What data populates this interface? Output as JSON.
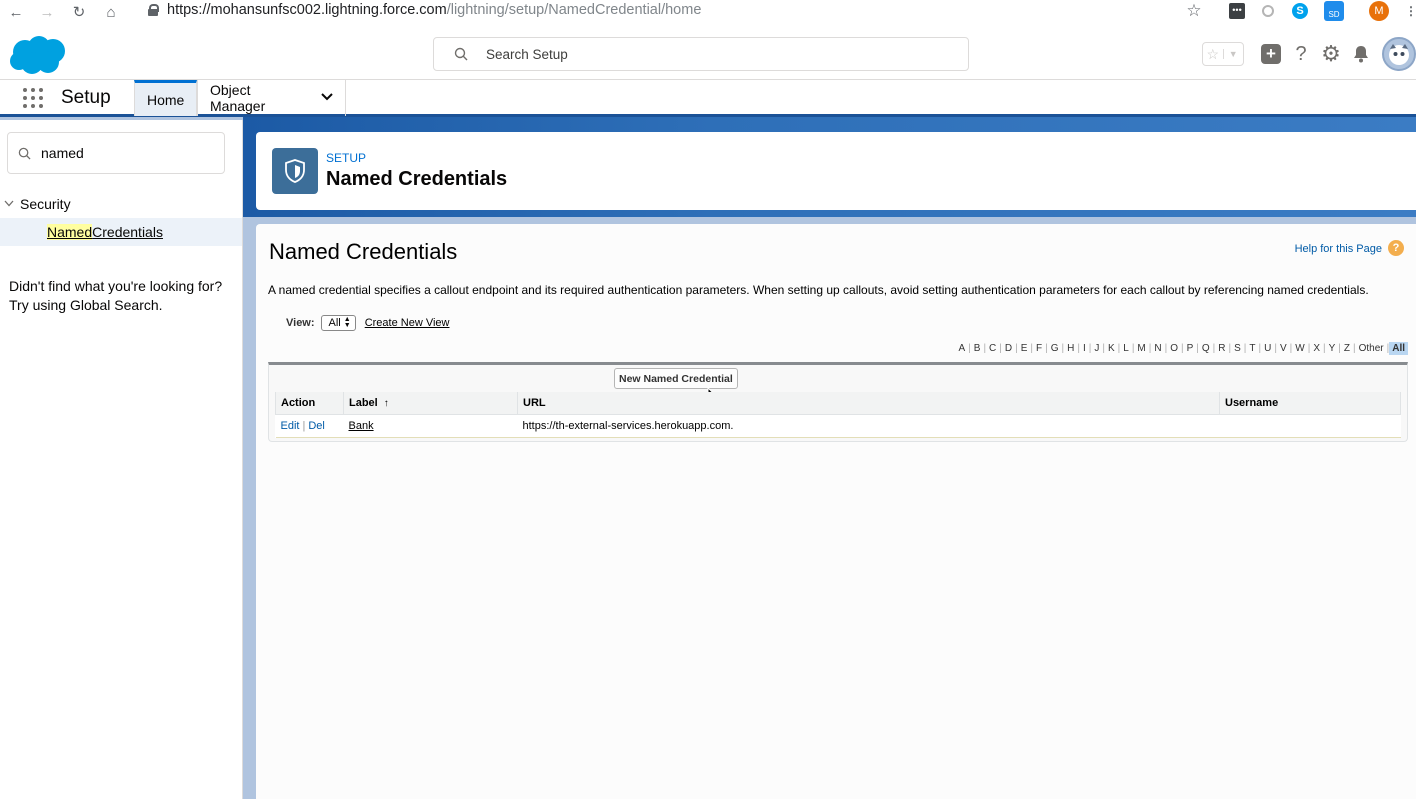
{
  "browser": {
    "url_host": "https://mohansunfsc002.lightning.force.com",
    "url_path": "/lightning/setup/NamedCredential/home",
    "profile_initial": "M"
  },
  "header": {
    "search_placeholder": "Search Setup"
  },
  "app_nav": {
    "app_name": "Setup",
    "tabs": [
      {
        "label": "Home"
      },
      {
        "label": "Object Manager"
      }
    ]
  },
  "sidebar": {
    "search_value": "named",
    "section_label": "Security",
    "item_highlight": "Named",
    "item_rest": " Credentials",
    "not_found_line1": "Didn't find what you're looking for?",
    "not_found_line2": "Try using Global Search."
  },
  "page_header": {
    "eyebrow": "SETUP",
    "title": "Named Credentials"
  },
  "content": {
    "heading": "Named Credentials",
    "help_link": "Help for this Page",
    "description": "A named credential specifies a callout endpoint and its required authentication parameters. When setting up callouts, avoid setting authentication parameters for each callout by referencing named credentials.",
    "view_label": "View:",
    "view_value": "All",
    "create_view": "Create New View",
    "alphabet": [
      "A",
      "B",
      "C",
      "D",
      "E",
      "F",
      "G",
      "H",
      "I",
      "J",
      "K",
      "L",
      "M",
      "N",
      "O",
      "P",
      "Q",
      "R",
      "S",
      "T",
      "U",
      "V",
      "W",
      "X",
      "Y",
      "Z",
      "Other"
    ],
    "alphabet_all": "All",
    "new_button": "New Named Credential",
    "columns": [
      "Action",
      "Label",
      "URL",
      "Username"
    ],
    "sort_indicator": "↑",
    "rows": [
      {
        "edit": "Edit",
        "del": "Del",
        "label": "Bank",
        "url": "https://th-external-services.herokuapp.com.",
        "username": ""
      }
    ]
  },
  "colors": {
    "brand_blue": "#0070d2",
    "nav_bar": "#1b5297",
    "header_icon": "#3c6e99",
    "help_icon": "#f3ae4e"
  }
}
